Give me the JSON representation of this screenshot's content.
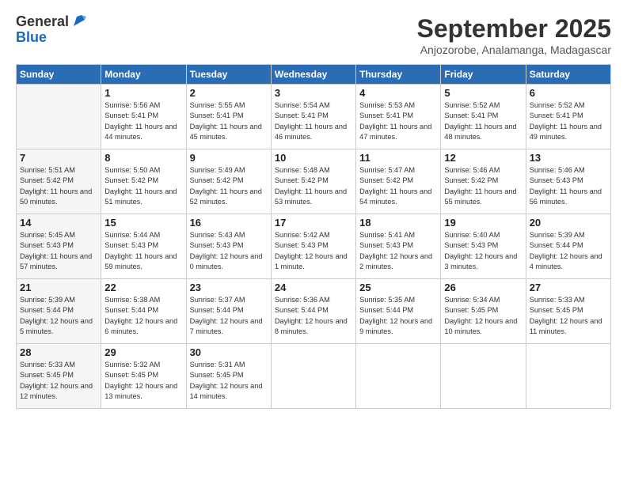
{
  "logo": {
    "general": "General",
    "blue": "Blue"
  },
  "title": "September 2025",
  "subtitle": "Anjozorobe, Analamanga, Madagascar",
  "days_header": [
    "Sunday",
    "Monday",
    "Tuesday",
    "Wednesday",
    "Thursday",
    "Friday",
    "Saturday"
  ],
  "weeks": [
    [
      {
        "day": "",
        "info": ""
      },
      {
        "day": "1",
        "info": "Sunrise: 5:56 AM\nSunset: 5:41 PM\nDaylight: 11 hours\nand 44 minutes."
      },
      {
        "day": "2",
        "info": "Sunrise: 5:55 AM\nSunset: 5:41 PM\nDaylight: 11 hours\nand 45 minutes."
      },
      {
        "day": "3",
        "info": "Sunrise: 5:54 AM\nSunset: 5:41 PM\nDaylight: 11 hours\nand 46 minutes."
      },
      {
        "day": "4",
        "info": "Sunrise: 5:53 AM\nSunset: 5:41 PM\nDaylight: 11 hours\nand 47 minutes."
      },
      {
        "day": "5",
        "info": "Sunrise: 5:52 AM\nSunset: 5:41 PM\nDaylight: 11 hours\nand 48 minutes."
      },
      {
        "day": "6",
        "info": "Sunrise: 5:52 AM\nSunset: 5:41 PM\nDaylight: 11 hours\nand 49 minutes."
      }
    ],
    [
      {
        "day": "7",
        "info": "Sunrise: 5:51 AM\nSunset: 5:42 PM\nDaylight: 11 hours\nand 50 minutes."
      },
      {
        "day": "8",
        "info": "Sunrise: 5:50 AM\nSunset: 5:42 PM\nDaylight: 11 hours\nand 51 minutes."
      },
      {
        "day": "9",
        "info": "Sunrise: 5:49 AM\nSunset: 5:42 PM\nDaylight: 11 hours\nand 52 minutes."
      },
      {
        "day": "10",
        "info": "Sunrise: 5:48 AM\nSunset: 5:42 PM\nDaylight: 11 hours\nand 53 minutes."
      },
      {
        "day": "11",
        "info": "Sunrise: 5:47 AM\nSunset: 5:42 PM\nDaylight: 11 hours\nand 54 minutes."
      },
      {
        "day": "12",
        "info": "Sunrise: 5:46 AM\nSunset: 5:42 PM\nDaylight: 11 hours\nand 55 minutes."
      },
      {
        "day": "13",
        "info": "Sunrise: 5:46 AM\nSunset: 5:43 PM\nDaylight: 11 hours\nand 56 minutes."
      }
    ],
    [
      {
        "day": "14",
        "info": "Sunrise: 5:45 AM\nSunset: 5:43 PM\nDaylight: 11 hours\nand 57 minutes."
      },
      {
        "day": "15",
        "info": "Sunrise: 5:44 AM\nSunset: 5:43 PM\nDaylight: 11 hours\nand 59 minutes."
      },
      {
        "day": "16",
        "info": "Sunrise: 5:43 AM\nSunset: 5:43 PM\nDaylight: 12 hours\nand 0 minutes."
      },
      {
        "day": "17",
        "info": "Sunrise: 5:42 AM\nSunset: 5:43 PM\nDaylight: 12 hours\nand 1 minute."
      },
      {
        "day": "18",
        "info": "Sunrise: 5:41 AM\nSunset: 5:43 PM\nDaylight: 12 hours\nand 2 minutes."
      },
      {
        "day": "19",
        "info": "Sunrise: 5:40 AM\nSunset: 5:43 PM\nDaylight: 12 hours\nand 3 minutes."
      },
      {
        "day": "20",
        "info": "Sunrise: 5:39 AM\nSunset: 5:44 PM\nDaylight: 12 hours\nand 4 minutes."
      }
    ],
    [
      {
        "day": "21",
        "info": "Sunrise: 5:39 AM\nSunset: 5:44 PM\nDaylight: 12 hours\nand 5 minutes."
      },
      {
        "day": "22",
        "info": "Sunrise: 5:38 AM\nSunset: 5:44 PM\nDaylight: 12 hours\nand 6 minutes."
      },
      {
        "day": "23",
        "info": "Sunrise: 5:37 AM\nSunset: 5:44 PM\nDaylight: 12 hours\nand 7 minutes."
      },
      {
        "day": "24",
        "info": "Sunrise: 5:36 AM\nSunset: 5:44 PM\nDaylight: 12 hours\nand 8 minutes."
      },
      {
        "day": "25",
        "info": "Sunrise: 5:35 AM\nSunset: 5:44 PM\nDaylight: 12 hours\nand 9 minutes."
      },
      {
        "day": "26",
        "info": "Sunrise: 5:34 AM\nSunset: 5:45 PM\nDaylight: 12 hours\nand 10 minutes."
      },
      {
        "day": "27",
        "info": "Sunrise: 5:33 AM\nSunset: 5:45 PM\nDaylight: 12 hours\nand 11 minutes."
      }
    ],
    [
      {
        "day": "28",
        "info": "Sunrise: 5:33 AM\nSunset: 5:45 PM\nDaylight: 12 hours\nand 12 minutes."
      },
      {
        "day": "29",
        "info": "Sunrise: 5:32 AM\nSunset: 5:45 PM\nDaylight: 12 hours\nand 13 minutes."
      },
      {
        "day": "30",
        "info": "Sunrise: 5:31 AM\nSunset: 5:45 PM\nDaylight: 12 hours\nand 14 minutes."
      },
      {
        "day": "",
        "info": ""
      },
      {
        "day": "",
        "info": ""
      },
      {
        "day": "",
        "info": ""
      },
      {
        "day": "",
        "info": ""
      }
    ]
  ]
}
